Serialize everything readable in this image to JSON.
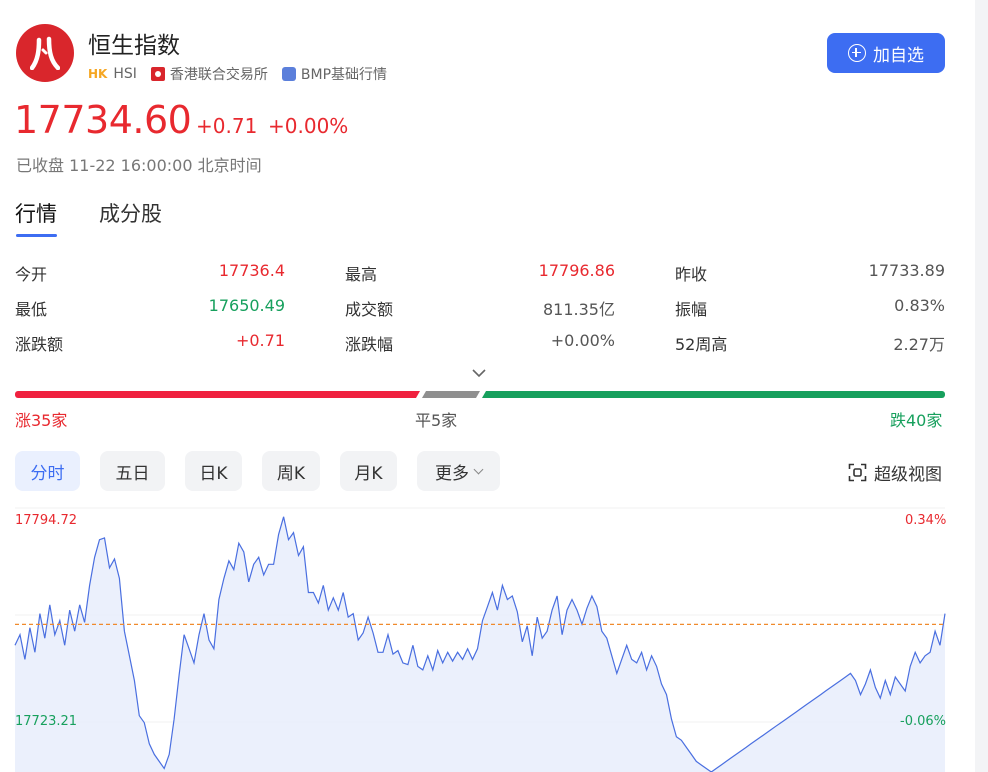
{
  "header": {
    "title": "恒生指数",
    "market_tag": "HK",
    "symbol": "HSI",
    "exchange": "香港联合交易所",
    "data_source": "BMP基础行情",
    "add_button_label": "加自选"
  },
  "quote": {
    "price": "17734.60",
    "change": "+0.71",
    "change_pct": "+0.00%",
    "status": "已收盘 11-22 16:00:00 北京时间"
  },
  "tabs": [
    {
      "label": "行情",
      "active": true
    },
    {
      "label": "成分股",
      "active": false
    }
  ],
  "stats": [
    {
      "label": "今开",
      "value": "17736.4",
      "color": "red"
    },
    {
      "label": "最高",
      "value": "17796.86",
      "color": "red"
    },
    {
      "label": "昨收",
      "value": "17733.89",
      "color": "gray"
    },
    {
      "label": "最低",
      "value": "17650.49",
      "color": "green"
    },
    {
      "label": "成交额",
      "value": "811.35亿",
      "color": "gray"
    },
    {
      "label": "振幅",
      "value": "0.83%",
      "color": "gray"
    },
    {
      "label": "涨跌额",
      "value": "+0.71",
      "color": "red"
    },
    {
      "label": "涨跌幅",
      "value": "+0.00%",
      "color": "gray"
    },
    {
      "label": "52周高",
      "value": "2.27万",
      "color": "gray"
    }
  ],
  "breadth": {
    "up_label": "涨35家",
    "flat_label": "平5家",
    "down_label": "跌40家",
    "up": 35,
    "flat": 5,
    "down": 40
  },
  "periods": [
    {
      "label": "分时",
      "active": true
    },
    {
      "label": "五日",
      "active": false
    },
    {
      "label": "日K",
      "active": false
    },
    {
      "label": "周K",
      "active": false
    },
    {
      "label": "月K",
      "active": false
    },
    {
      "label": "更多",
      "active": false
    }
  ],
  "super_view_label": "超级视图",
  "colors": {
    "up": "#e8292f",
    "down": "#17a05d",
    "accent": "#3d6df2",
    "line": "#4a6fe0",
    "prev_close_line": "#f08a2c"
  },
  "chart_data": {
    "type": "line",
    "y_labels_left": [
      "17794.72",
      "17723.21"
    ],
    "y_labels_right": [
      "0.34%",
      "-0.06%"
    ],
    "prev_close": 17733.89,
    "ylim": [
      17650,
      17800
    ],
    "values": [
      17722,
      17728,
      17714,
      17732,
      17718,
      17740,
      17726,
      17745,
      17728,
      17736,
      17722,
      17742,
      17730,
      17745,
      17735,
      17756,
      17772,
      17782,
      17783,
      17766,
      17771,
      17760,
      17730,
      17716,
      17702,
      17682,
      17678,
      17666,
      17660,
      17656,
      17652,
      17660,
      17680,
      17705,
      17728,
      17720,
      17712,
      17728,
      17740,
      17725,
      17720,
      17748,
      17760,
      17770,
      17765,
      17780,
      17775,
      17758,
      17768,
      17772,
      17762,
      17768,
      17768,
      17785,
      17795,
      17782,
      17786,
      17773,
      17778,
      17752,
      17752,
      17746,
      17756,
      17742,
      17749,
      17742,
      17752,
      17738,
      17740,
      17725,
      17729,
      17738,
      17729,
      17718,
      17718,
      17728,
      17717,
      17719,
      17712,
      17711,
      17722,
      17710,
      17708,
      17716,
      17708,
      17719,
      17712,
      17718,
      17713,
      17718,
      17714,
      17720,
      17714,
      17720,
      17736,
      17744,
      17752,
      17742,
      17756,
      17748,
      17750,
      17741,
      17724,
      17733,
      17716,
      17738,
      17726,
      17730,
      17742,
      17750,
      17728,
      17742,
      17748,
      17742,
      17734,
      17743,
      17750,
      17744,
      17730,
      17726,
      17716,
      17706,
      17714,
      17722,
      17714,
      17712,
      17718,
      17708,
      17716,
      17710,
      17700,
      17694,
      17680,
      17670,
      17668,
      17664,
      17660,
      17656,
      17654,
      17652,
      17650,
      17652,
      17654,
      17656,
      17658,
      17660,
      17662,
      17664,
      17666,
      17668,
      17670,
      17672,
      17674,
      17676,
      17678,
      17680,
      17682,
      17684,
      17686,
      17688,
      17690,
      17692,
      17694,
      17696,
      17698,
      17700,
      17702,
      17704,
      17706,
      17702,
      17694,
      17700,
      17708,
      17698,
      17692,
      17702,
      17694,
      17704,
      17700,
      17696,
      17710,
      17718,
      17712,
      17716,
      17718,
      17730,
      17722,
      17740
    ]
  }
}
